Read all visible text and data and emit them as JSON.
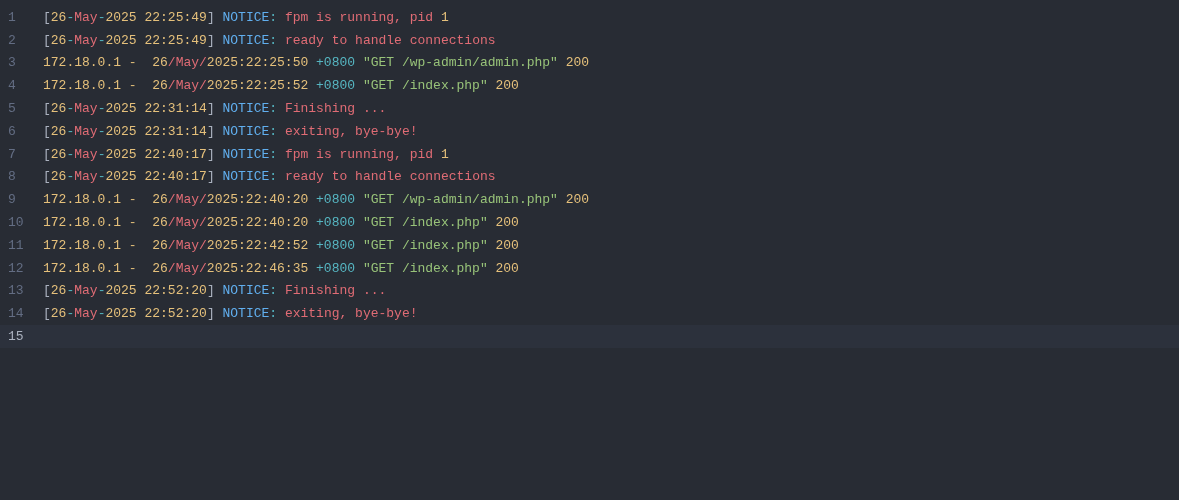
{
  "lines": [
    {
      "number": "1",
      "current": false,
      "tokens": [
        {
          "text": "[",
          "color": "#abb2bf"
        },
        {
          "text": "26",
          "color": "#e5c07b"
        },
        {
          "text": "-",
          "color": "#56b6c2"
        },
        {
          "text": "May",
          "color": "#e06c75"
        },
        {
          "text": "-",
          "color": "#56b6c2"
        },
        {
          "text": "2025 22:25:49",
          "color": "#e5c07b"
        },
        {
          "text": "] ",
          "color": "#abb2bf"
        },
        {
          "text": "NOTICE",
          "color": "#61afef"
        },
        {
          "text": ": ",
          "color": "#56b6c2"
        },
        {
          "text": "fpm is running, pid ",
          "color": "#e06c75"
        },
        {
          "text": "1",
          "color": "#e5c07b"
        }
      ]
    },
    {
      "number": "2",
      "current": false,
      "tokens": [
        {
          "text": "[",
          "color": "#abb2bf"
        },
        {
          "text": "26",
          "color": "#e5c07b"
        },
        {
          "text": "-",
          "color": "#56b6c2"
        },
        {
          "text": "May",
          "color": "#e06c75"
        },
        {
          "text": "-",
          "color": "#56b6c2"
        },
        {
          "text": "2025 22:25:49",
          "color": "#e5c07b"
        },
        {
          "text": "] ",
          "color": "#abb2bf"
        },
        {
          "text": "NOTICE",
          "color": "#61afef"
        },
        {
          "text": ": ",
          "color": "#56b6c2"
        },
        {
          "text": "ready to handle connections",
          "color": "#e06c75"
        }
      ]
    },
    {
      "number": "3",
      "current": false,
      "tokens": [
        {
          "text": "172.18.0.1 -  26",
          "color": "#e5c07b"
        },
        {
          "text": "/May/",
          "color": "#e06c75"
        },
        {
          "text": "2025:22:25:50 ",
          "color": "#e5c07b"
        },
        {
          "text": "+0800 ",
          "color": "#56b6c2"
        },
        {
          "text": "\"GET /wp-admin/admin.php\"",
          "color": "#98c379"
        },
        {
          "text": " 200",
          "color": "#e5c07b"
        }
      ]
    },
    {
      "number": "4",
      "current": false,
      "tokens": [
        {
          "text": "172.18.0.1 -  26",
          "color": "#e5c07b"
        },
        {
          "text": "/May/",
          "color": "#e06c75"
        },
        {
          "text": "2025:22:25:52 ",
          "color": "#e5c07b"
        },
        {
          "text": "+0800 ",
          "color": "#56b6c2"
        },
        {
          "text": "\"GET /index.php\"",
          "color": "#98c379"
        },
        {
          "text": " 200",
          "color": "#e5c07b"
        }
      ]
    },
    {
      "number": "5",
      "current": false,
      "tokens": [
        {
          "text": "[",
          "color": "#abb2bf"
        },
        {
          "text": "26",
          "color": "#e5c07b"
        },
        {
          "text": "-",
          "color": "#56b6c2"
        },
        {
          "text": "May",
          "color": "#e06c75"
        },
        {
          "text": "-",
          "color": "#56b6c2"
        },
        {
          "text": "2025 22:31:14",
          "color": "#e5c07b"
        },
        {
          "text": "] ",
          "color": "#abb2bf"
        },
        {
          "text": "NOTICE",
          "color": "#61afef"
        },
        {
          "text": ": ",
          "color": "#56b6c2"
        },
        {
          "text": "Finishing ...",
          "color": "#e06c75"
        }
      ]
    },
    {
      "number": "6",
      "current": false,
      "tokens": [
        {
          "text": "[",
          "color": "#abb2bf"
        },
        {
          "text": "26",
          "color": "#e5c07b"
        },
        {
          "text": "-",
          "color": "#56b6c2"
        },
        {
          "text": "May",
          "color": "#e06c75"
        },
        {
          "text": "-",
          "color": "#56b6c2"
        },
        {
          "text": "2025 22:31:14",
          "color": "#e5c07b"
        },
        {
          "text": "] ",
          "color": "#abb2bf"
        },
        {
          "text": "NOTICE",
          "color": "#61afef"
        },
        {
          "text": ": ",
          "color": "#56b6c2"
        },
        {
          "text": "exiting, bye-bye!",
          "color": "#e06c75"
        }
      ]
    },
    {
      "number": "7",
      "current": false,
      "tokens": [
        {
          "text": "[",
          "color": "#abb2bf"
        },
        {
          "text": "26",
          "color": "#e5c07b"
        },
        {
          "text": "-",
          "color": "#56b6c2"
        },
        {
          "text": "May",
          "color": "#e06c75"
        },
        {
          "text": "-",
          "color": "#56b6c2"
        },
        {
          "text": "2025 22:40:17",
          "color": "#e5c07b"
        },
        {
          "text": "] ",
          "color": "#abb2bf"
        },
        {
          "text": "NOTICE",
          "color": "#61afef"
        },
        {
          "text": ": ",
          "color": "#56b6c2"
        },
        {
          "text": "fpm is running, pid ",
          "color": "#e06c75"
        },
        {
          "text": "1",
          "color": "#e5c07b"
        }
      ]
    },
    {
      "number": "8",
      "current": false,
      "tokens": [
        {
          "text": "[",
          "color": "#abb2bf"
        },
        {
          "text": "26",
          "color": "#e5c07b"
        },
        {
          "text": "-",
          "color": "#56b6c2"
        },
        {
          "text": "May",
          "color": "#e06c75"
        },
        {
          "text": "-",
          "color": "#56b6c2"
        },
        {
          "text": "2025 22:40:17",
          "color": "#e5c07b"
        },
        {
          "text": "] ",
          "color": "#abb2bf"
        },
        {
          "text": "NOTICE",
          "color": "#61afef"
        },
        {
          "text": ": ",
          "color": "#56b6c2"
        },
        {
          "text": "ready to handle connections",
          "color": "#e06c75"
        }
      ]
    },
    {
      "number": "9",
      "current": false,
      "tokens": [
        {
          "text": "172.18.0.1 -  26",
          "color": "#e5c07b"
        },
        {
          "text": "/May/",
          "color": "#e06c75"
        },
        {
          "text": "2025:22:40:20 ",
          "color": "#e5c07b"
        },
        {
          "text": "+0800 ",
          "color": "#56b6c2"
        },
        {
          "text": "\"GET /wp-admin/admin.php\"",
          "color": "#98c379"
        },
        {
          "text": " 200",
          "color": "#e5c07b"
        }
      ]
    },
    {
      "number": "10",
      "current": false,
      "tokens": [
        {
          "text": "172.18.0.1 -  26",
          "color": "#e5c07b"
        },
        {
          "text": "/May/",
          "color": "#e06c75"
        },
        {
          "text": "2025:22:40:20 ",
          "color": "#e5c07b"
        },
        {
          "text": "+0800 ",
          "color": "#56b6c2"
        },
        {
          "text": "\"GET /index.php\"",
          "color": "#98c379"
        },
        {
          "text": " 200",
          "color": "#e5c07b"
        }
      ]
    },
    {
      "number": "11",
      "current": false,
      "tokens": [
        {
          "text": "172.18.0.1 -  26",
          "color": "#e5c07b"
        },
        {
          "text": "/May/",
          "color": "#e06c75"
        },
        {
          "text": "2025:22:42:52 ",
          "color": "#e5c07b"
        },
        {
          "text": "+0800 ",
          "color": "#56b6c2"
        },
        {
          "text": "\"GET /index.php\"",
          "color": "#98c379"
        },
        {
          "text": " 200",
          "color": "#e5c07b"
        }
      ]
    },
    {
      "number": "12",
      "current": false,
      "tokens": [
        {
          "text": "172.18.0.1 -  26",
          "color": "#e5c07b"
        },
        {
          "text": "/May/",
          "color": "#e06c75"
        },
        {
          "text": "2025:22:46:35 ",
          "color": "#e5c07b"
        },
        {
          "text": "+0800 ",
          "color": "#56b6c2"
        },
        {
          "text": "\"GET /index.php\"",
          "color": "#98c379"
        },
        {
          "text": " 200",
          "color": "#e5c07b"
        }
      ]
    },
    {
      "number": "13",
      "current": false,
      "tokens": [
        {
          "text": "[",
          "color": "#abb2bf"
        },
        {
          "text": "26",
          "color": "#e5c07b"
        },
        {
          "text": "-",
          "color": "#56b6c2"
        },
        {
          "text": "May",
          "color": "#e06c75"
        },
        {
          "text": "-",
          "color": "#56b6c2"
        },
        {
          "text": "2025 22:52:20",
          "color": "#e5c07b"
        },
        {
          "text": "] ",
          "color": "#abb2bf"
        },
        {
          "text": "NOTICE",
          "color": "#61afef"
        },
        {
          "text": ": ",
          "color": "#56b6c2"
        },
        {
          "text": "Finishing ...",
          "color": "#e06c75"
        }
      ]
    },
    {
      "number": "14",
      "current": false,
      "tokens": [
        {
          "text": "[",
          "color": "#abb2bf"
        },
        {
          "text": "26",
          "color": "#e5c07b"
        },
        {
          "text": "-",
          "color": "#56b6c2"
        },
        {
          "text": "May",
          "color": "#e06c75"
        },
        {
          "text": "-",
          "color": "#56b6c2"
        },
        {
          "text": "2025 22:52:20",
          "color": "#e5c07b"
        },
        {
          "text": "] ",
          "color": "#abb2bf"
        },
        {
          "text": "NOTICE",
          "color": "#61afef"
        },
        {
          "text": ": ",
          "color": "#56b6c2"
        },
        {
          "text": "exiting, bye-bye!",
          "color": "#e06c75"
        }
      ]
    },
    {
      "number": "15",
      "current": true
    }
  ]
}
